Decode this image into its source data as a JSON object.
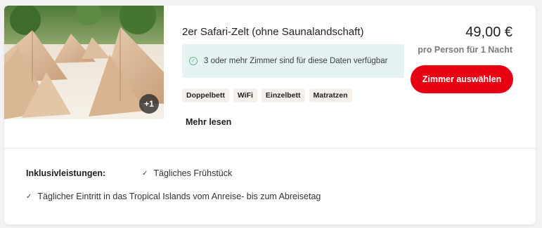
{
  "room": {
    "title": "2er Safari-Zelt (ohne Saunalandschaft)",
    "more_photos_badge": "+1",
    "availability_text": "3 oder mehr Zimmer sind für diese Daten verfügbar",
    "price": "49,00 €",
    "price_note": "pro Person für 1 Nacht",
    "select_button_label": "Zimmer auswählen",
    "amenities": [
      "Doppelbett",
      "WiFi",
      "Einzelbett",
      "Matratzen"
    ],
    "read_more_label": "Mehr lesen"
  },
  "inclusions": {
    "label": "Inklusivleistungen:",
    "items": [
      "Tägliches Frühstück",
      "Täglicher Eintritt in das Tropical Islands vom Anreise- bis zum Abreisetag"
    ]
  },
  "colors": {
    "accent_button": "#e60012",
    "availability_bg": "#e5f4f3",
    "availability_icon": "#5fb88c",
    "amenity_bg": "#f5f0ea"
  },
  "icons": {
    "availability": "check-circle-icon",
    "inclusion": "checkmark-icon",
    "photo": "safari-tents-photo"
  }
}
